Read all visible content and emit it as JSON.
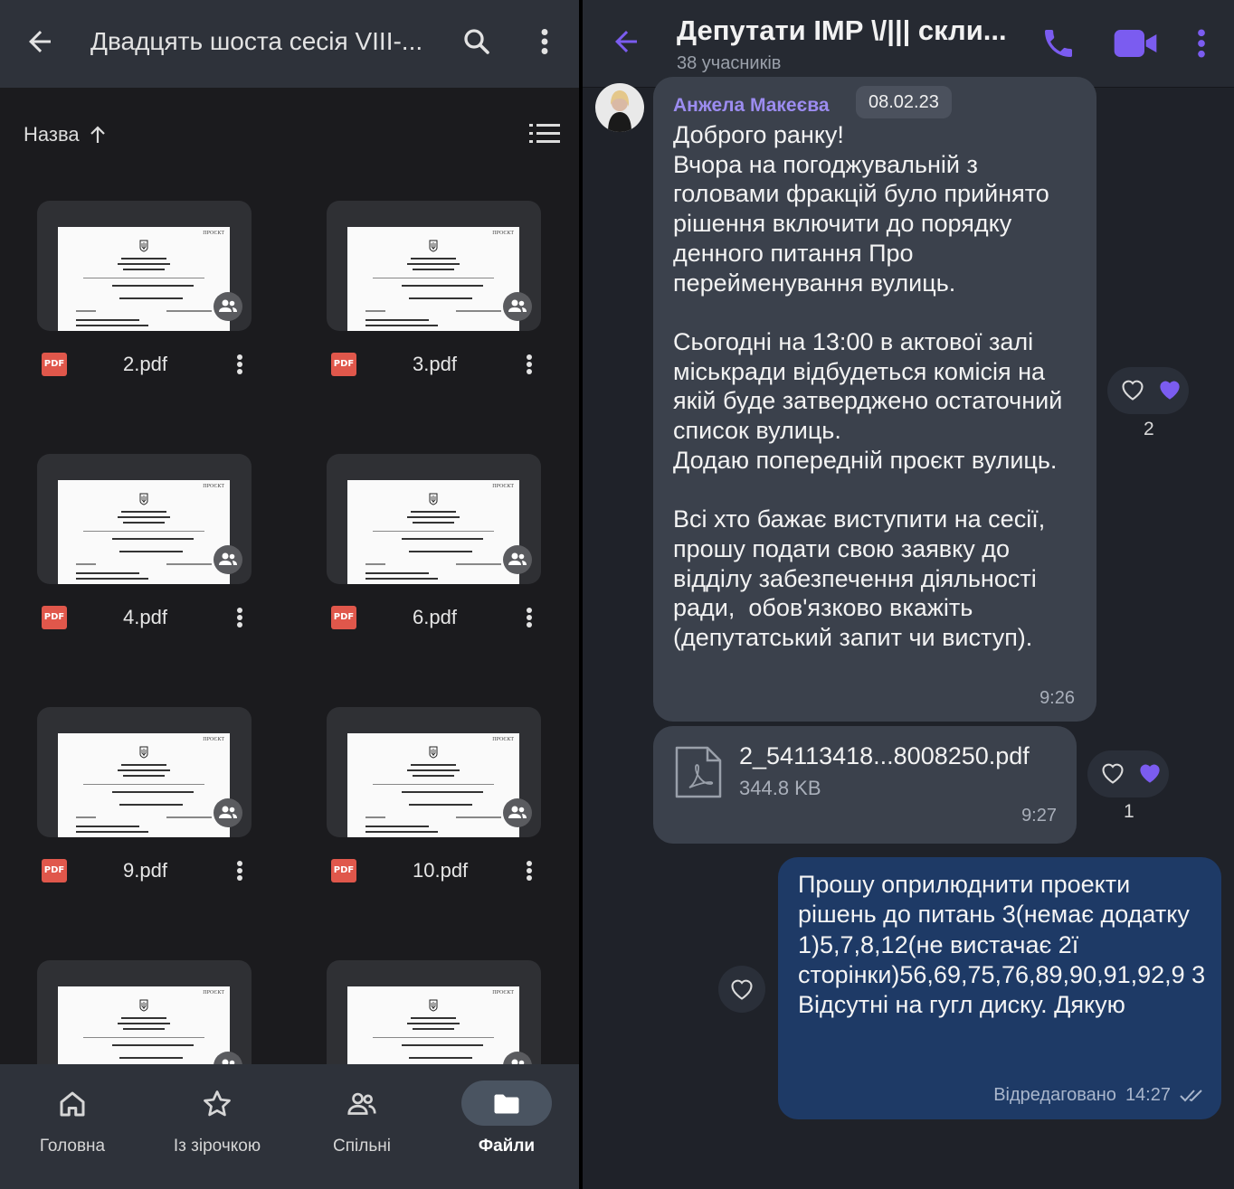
{
  "drive": {
    "title": "Двадцять шоста сесія VIII-...",
    "sort_label": "Назва",
    "files": [
      {
        "name": "2.pdf",
        "badge": "PDF"
      },
      {
        "name": "3.pdf",
        "badge": "PDF"
      },
      {
        "name": "4.pdf",
        "badge": "PDF"
      },
      {
        "name": "6.pdf",
        "badge": "PDF"
      },
      {
        "name": "9.pdf",
        "badge": "PDF"
      },
      {
        "name": "10.pdf",
        "badge": "PDF"
      }
    ],
    "thumb_label": "ПРОЄКТ",
    "nav": [
      {
        "label": "Головна",
        "icon": "home-icon"
      },
      {
        "label": "Із зірочкою",
        "icon": "star-icon"
      },
      {
        "label": "Спільні",
        "icon": "people-icon"
      },
      {
        "label": "Файли",
        "icon": "folder-icon"
      }
    ]
  },
  "chat": {
    "title": "Депутати ІМР \\/||| скли...",
    "subtitle": "38 учасників",
    "messages": {
      "m1": {
        "sender": "Анжела Макеєва",
        "date": "08.02.23",
        "text": "Доброго ранку!\nВчора на погоджувальній з головами фракцій було прийнято рішення включити до порядку денного питання Про перейменування вулиць.\n\nСьогодні на 13:00 в актової залі міськради відбудеться комісія на якій буде затверджено остаточний список вулиць.\nДодаю попередній проєкт вулиць.\n\nВсі хто бажає виступити на сесії, прошу подати свою заявку до відділу забезпечення діяльності ради,  обов'язково вкажіть (депутатський запит чи виступ).",
        "time": "9:26",
        "reaction_count": "2"
      },
      "m2": {
        "file_name": "2_54113418...8008250.pdf",
        "file_size": "344.8 KB",
        "time": "9:27",
        "reaction_count": "1"
      },
      "m3": {
        "text": "Прошу оприлюднити проекти рішень до питань 3(немає додатку 1)5,7,8,12(не вистачає 2ї сторінки)56,69,75,76,89,90,91,92,9 3\nВідсутні на гугл диску. Дякую",
        "edited": "Відредаговано",
        "time": "14:27"
      }
    }
  },
  "colors": {
    "accent": "#7b5cf0",
    "pdf_red": "#e0574b",
    "outgoing_bubble": "#1e3a66",
    "incoming_bubble": "#3b414c"
  }
}
